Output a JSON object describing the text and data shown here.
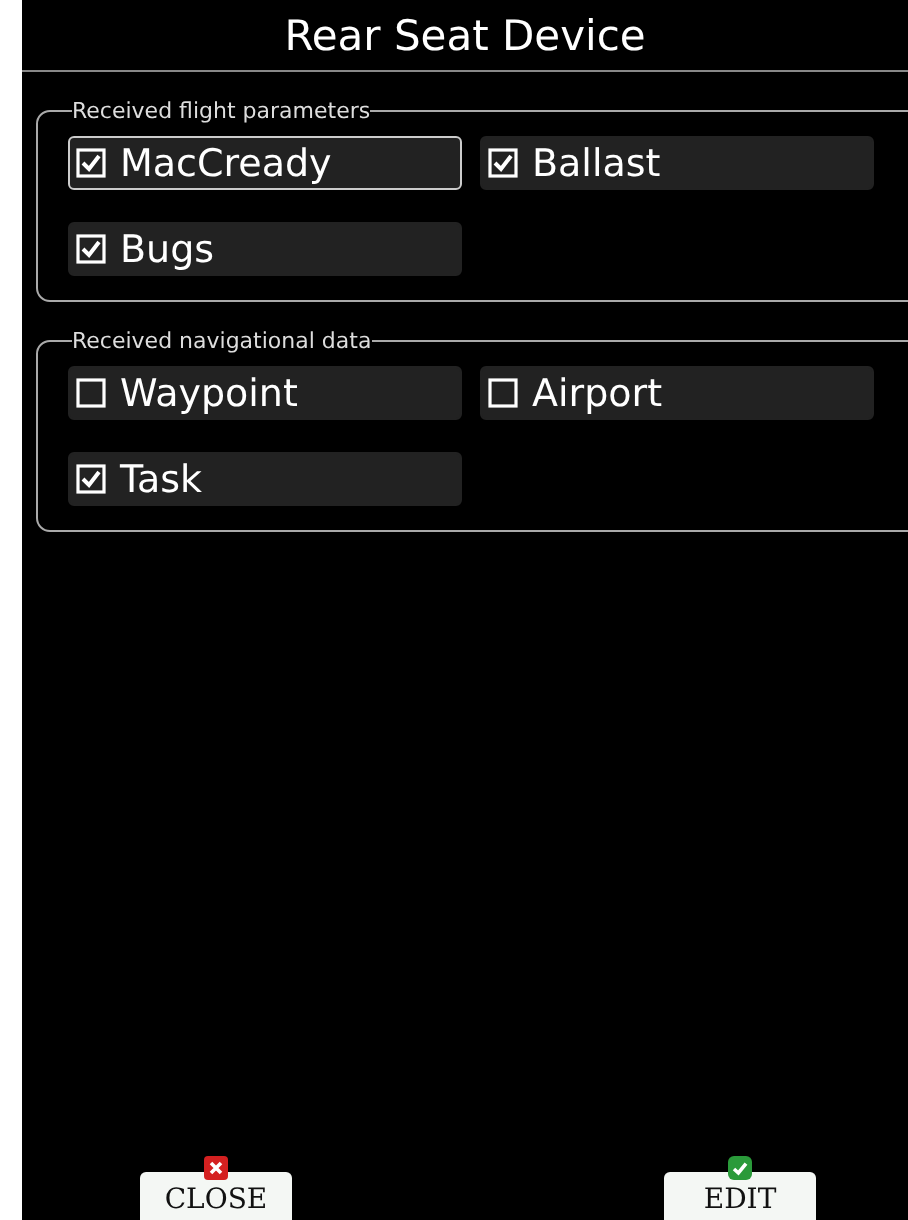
{
  "window": {
    "title": "Rear Seat Device"
  },
  "groups": [
    {
      "legend": "Received flight parameters",
      "items": [
        {
          "label": "MacCready",
          "checked": true,
          "focused": true
        },
        {
          "label": "Ballast",
          "checked": true,
          "focused": false
        },
        {
          "label": "Bugs",
          "checked": true,
          "focused": false
        }
      ]
    },
    {
      "legend": "Received navigational data",
      "items": [
        {
          "label": "Waypoint",
          "checked": false,
          "focused": false
        },
        {
          "label": "Airport",
          "checked": false,
          "focused": false
        },
        {
          "label": "Task",
          "checked": true,
          "focused": false
        }
      ]
    }
  ],
  "buttons": [
    {
      "label": "CLOSE",
      "kind": "cancel"
    },
    {
      "label": "EDIT",
      "kind": "confirm"
    }
  ]
}
